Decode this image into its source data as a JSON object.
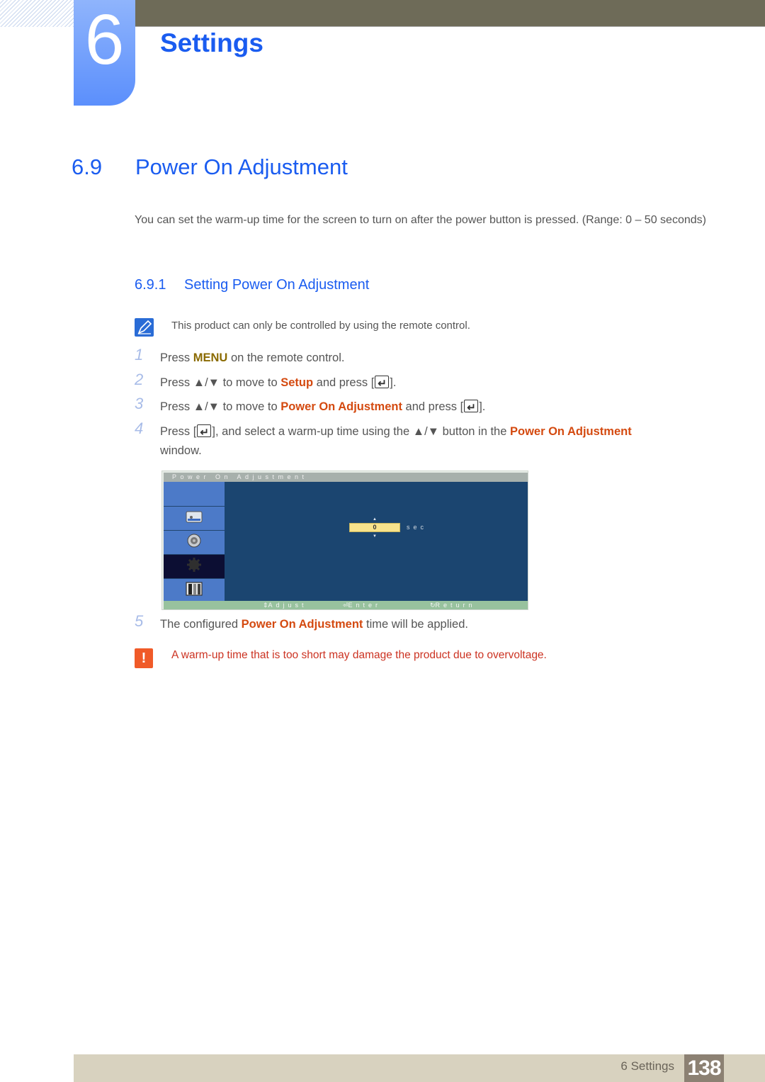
{
  "header": {
    "chapter_number": "6",
    "chapter_title": "Settings"
  },
  "section": {
    "number": "6.9",
    "title": "Power On Adjustment",
    "intro": "You can set the warm-up time for the screen to turn on after the power button is pressed. (Range: 0 – 50 seconds)"
  },
  "subsection": {
    "number": "6.9.1",
    "title": "Setting Power On Adjustment"
  },
  "note": {
    "icon": "note-pencil-icon",
    "text": "This product can only be controlled by using the remote control."
  },
  "steps": [
    {
      "num": "1",
      "pre": "Press ",
      "hl": "MENU",
      "post": " on the remote control."
    },
    {
      "num": "2",
      "pre": "Press ▲/▼ to move to ",
      "hl": "Setup",
      "post": " and press [",
      "post2": "]."
    },
    {
      "num": "3",
      "pre": "Press ▲/▼ to move to ",
      "hl": "Power On Adjustment",
      "post": " and press [",
      "post2": "]."
    },
    {
      "num": "4",
      "pre": "Press [",
      "mid": "], and select a warm-up time using the ▲/▼ button in the ",
      "hl": "Power On Adjustment",
      "line2": "window."
    },
    {
      "num": "5",
      "pre": "The configured ",
      "hl": "Power On Adjustment",
      "post": " time will be applied."
    }
  ],
  "osd": {
    "title": "Power On Adjustment",
    "value": "0",
    "unit": "sec",
    "footer": {
      "adjust": "Adjust",
      "enter": "Enter",
      "return": "Return"
    },
    "sidebar_icons": [
      "blank",
      "picture-icon",
      "sound-icon",
      "setup-gear-icon",
      "multi-window-icon"
    ],
    "selected_index": 3
  },
  "warning": {
    "icon": "exclamation-icon",
    "text": "A warm-up time that is too short may damage the product due to overvoltage."
  },
  "footer": {
    "label": "6 Settings",
    "page": "138"
  }
}
